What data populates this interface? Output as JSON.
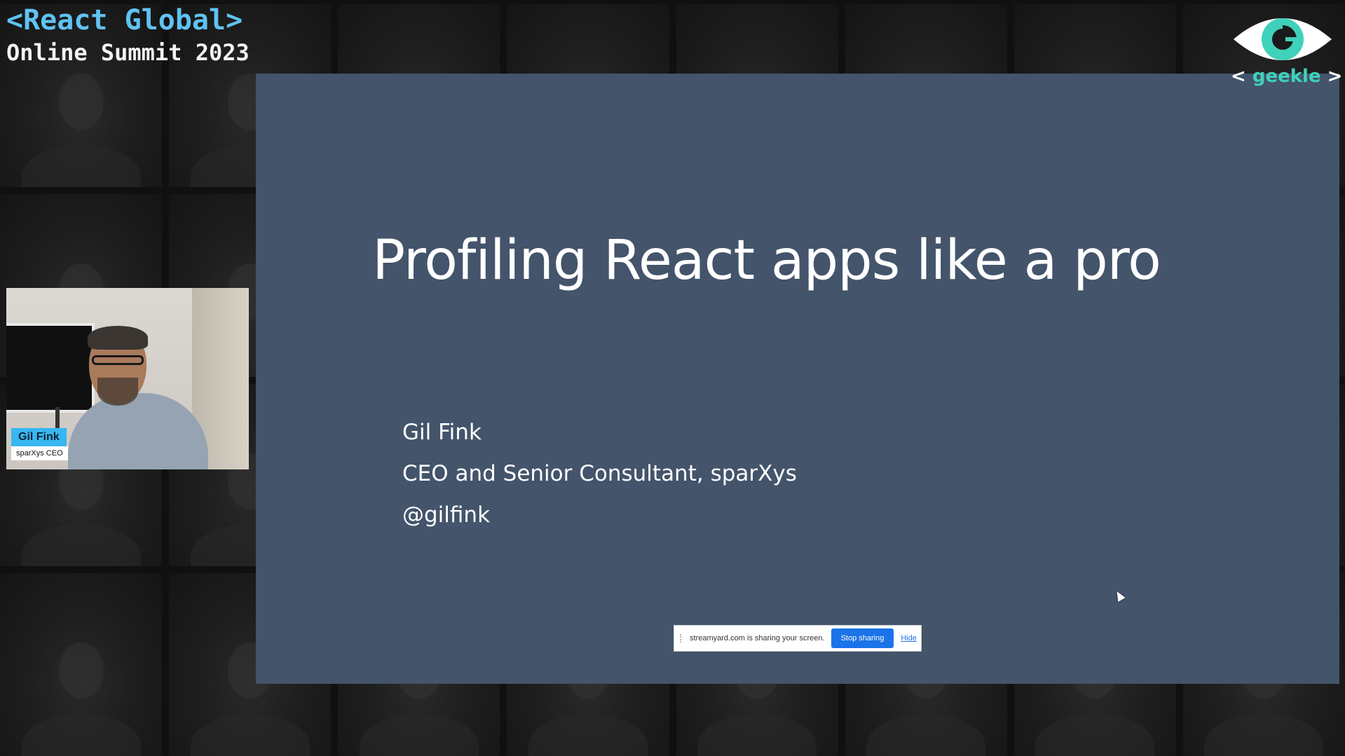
{
  "event": {
    "title_line1": "<React Global>",
    "title_line2": "Online Summit 2023"
  },
  "logo": {
    "brand_prefix": "<",
    "brand": "geekle",
    "brand_suffix": ">",
    "icon": "geekle-eye-logo-icon"
  },
  "slide": {
    "title": "Profiling React apps like a pro",
    "lines": [
      "Gil Fink",
      "CEO and Senior Consultant, sparXys",
      "@gilfink"
    ]
  },
  "speaker": {
    "name": "Gil Fink",
    "role": "sparXys CEO"
  },
  "screen_share_bar": {
    "message": "streamyard.com is sharing your screen.",
    "stop_label": "Stop sharing",
    "hide_label": "Hide"
  },
  "colors": {
    "event_title_accent": "#5fc3f2",
    "slide_background": "#43546b",
    "name_tag": "#38b6f1",
    "logo_accent": "#3fd1b9",
    "stop_button": "#1a73e8"
  }
}
